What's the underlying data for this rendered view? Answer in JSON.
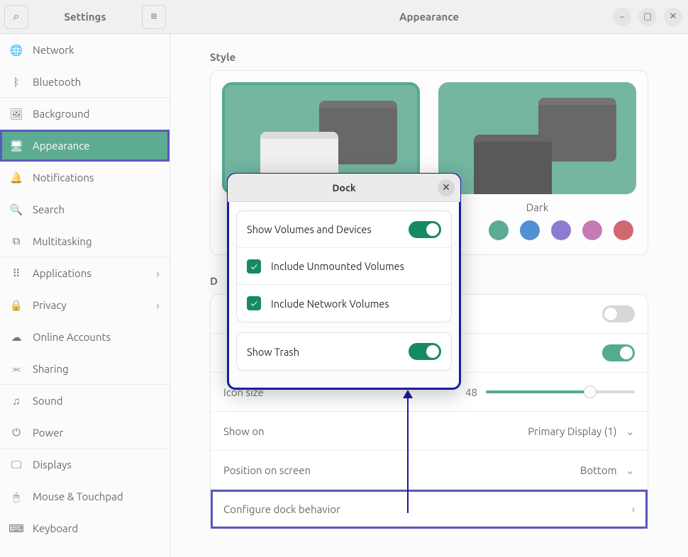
{
  "header": {
    "settings_title": "Settings",
    "page_title": "Appearance"
  },
  "sidebar": {
    "items": [
      {
        "icon": "🌐",
        "label": "Network"
      },
      {
        "icon": "ᛒ",
        "label": "Bluetooth"
      },
      {
        "icon": "🖼",
        "label": "Background"
      },
      {
        "icon": "🖥",
        "label": "Appearance"
      },
      {
        "icon": "🔔",
        "label": "Notifications"
      },
      {
        "icon": "🔍",
        "label": "Search"
      },
      {
        "icon": "⧉",
        "label": "Multitasking"
      },
      {
        "icon": "⠿",
        "label": "Applications"
      },
      {
        "icon": "🔒",
        "label": "Privacy"
      },
      {
        "icon": "☁",
        "label": "Online Accounts"
      },
      {
        "icon": "⫘",
        "label": "Sharing"
      },
      {
        "icon": "♫",
        "label": "Sound"
      },
      {
        "icon": "⏻",
        "label": "Power"
      },
      {
        "icon": "🖵",
        "label": "Displays"
      },
      {
        "icon": "🖱",
        "label": "Mouse & Touchpad"
      },
      {
        "icon": "⌨",
        "label": "Keyboard"
      }
    ]
  },
  "style": {
    "section_label": "Style",
    "dark_label": "Dark",
    "swatches": [
      "#1f8a6c",
      "#0f66c3",
      "#6048c0",
      "#b0499c",
      "#c02f3a"
    ]
  },
  "dock": {
    "section_letter": "D",
    "rows": {
      "icon_size_label": "Icon size",
      "icon_size_value": "48",
      "show_on_label": "Show on",
      "show_on_value": "Primary Display (1)",
      "position_label": "Position on screen",
      "position_value": "Bottom",
      "configure_label": "Configure dock behavior"
    }
  },
  "modal": {
    "title": "Dock",
    "show_volumes": "Show Volumes and Devices",
    "include_unmounted": "Include Unmounted Volumes",
    "include_network": "Include Network Volumes",
    "show_trash": "Show Trash"
  }
}
